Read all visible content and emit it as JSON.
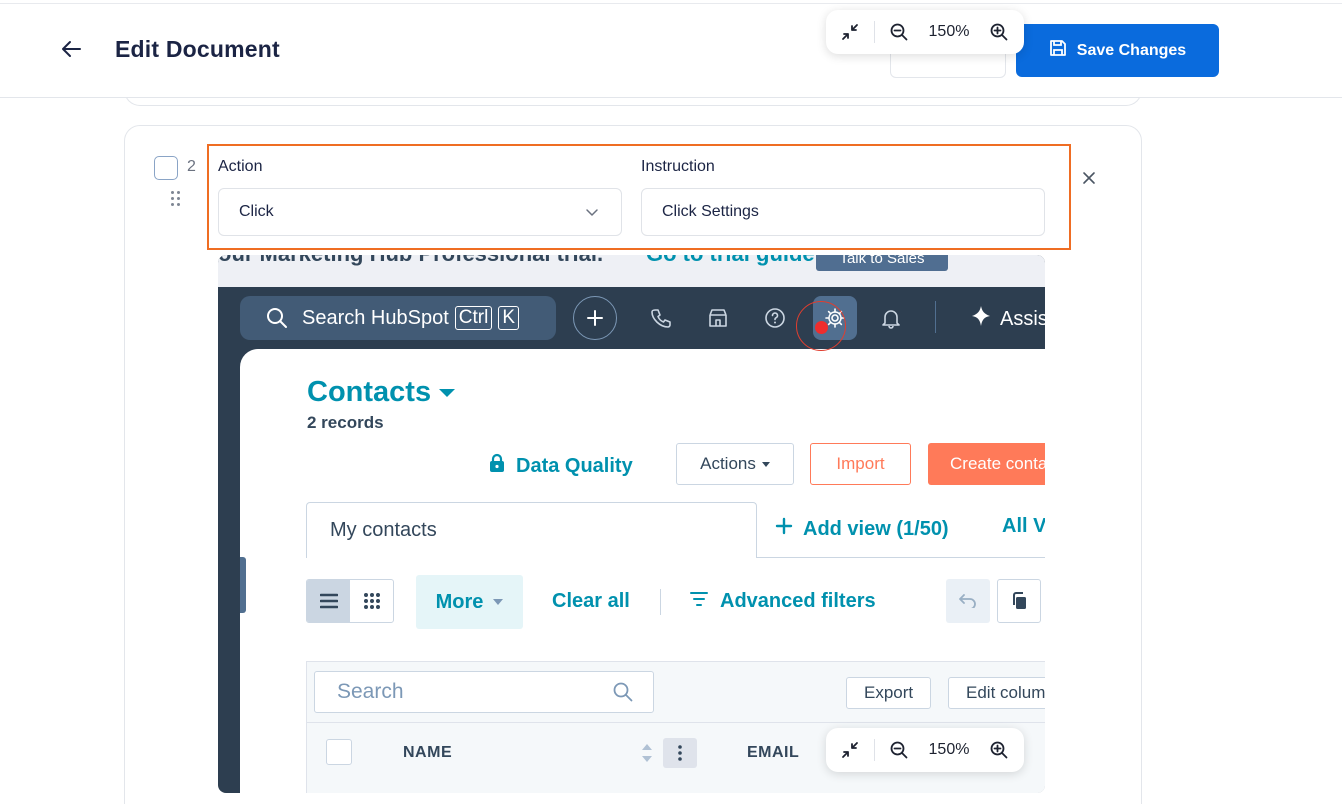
{
  "header": {
    "title": "Edit Document",
    "save_label": "Save Changes"
  },
  "zoom": {
    "value": "150%"
  },
  "step": {
    "number": "2",
    "action_label": "Action",
    "action_value": "Click",
    "instruction_label": "Instruction",
    "instruction_value": "Click Settings"
  },
  "screenshot": {
    "trial_text": "our Marketing Hub Professional trial.",
    "trial_link": "Go to trial guide",
    "trial_button": "Talk to Sales",
    "search_text": "Search HubSpot",
    "kbd_ctrl": "Ctrl",
    "kbd_k": "K",
    "assist_label": "Assis",
    "contacts_title": "Contacts",
    "records": "2 records",
    "data_quality": "Data Quality",
    "actions_btn": "Actions",
    "import_btn": "Import",
    "create_btn": "Create conta",
    "tab_my_contacts": "My contacts",
    "add_view": "Add view (1/50)",
    "all_views": "All V",
    "more_btn": "More",
    "clear_all": "Clear all",
    "advanced_filters": "Advanced filters",
    "search_placeholder": "Search",
    "export_btn": "Export",
    "edit_columns_btn": "Edit colum",
    "col_name": "NAME",
    "col_email": "EMAIL"
  },
  "colors": {
    "primary": "#0a6bdd",
    "highlight": "#ef6d23",
    "hubspot_teal": "#0091ae",
    "hubspot_orange": "#ff7a59",
    "hubspot_nav": "#2d3e50"
  }
}
